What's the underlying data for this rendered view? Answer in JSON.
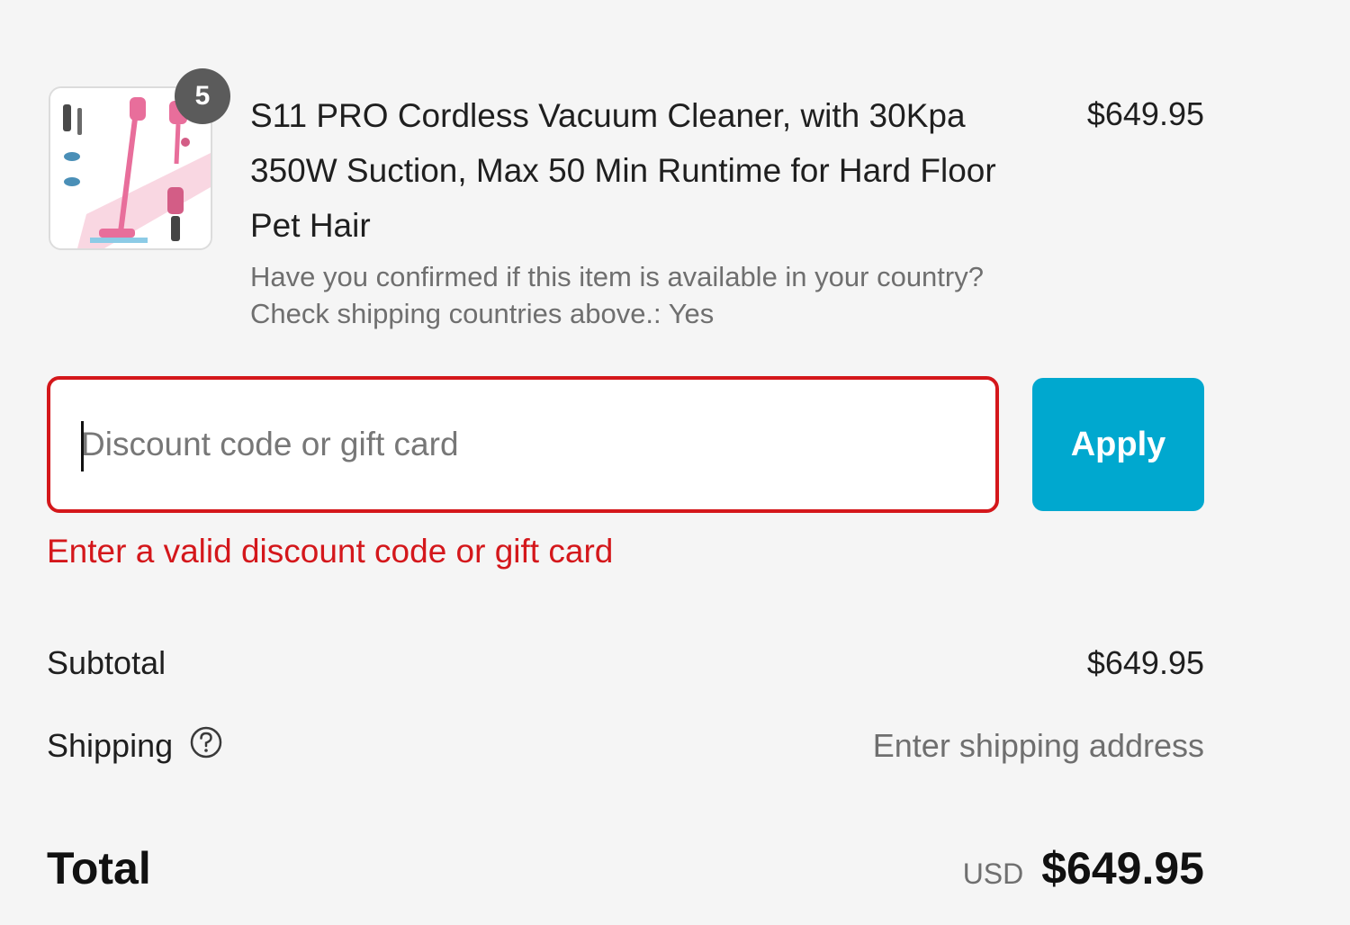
{
  "product": {
    "quantity": "5",
    "title": "S11 PRO Cordless Vacuum Cleaner, with 30Kpa 350W Suction, Max 50 Min Runtime for Hard Floor Pet Hair",
    "variant": "Have you confirmed if this item is available in your country? Check shipping countries above.: Yes",
    "price": "$649.95",
    "image_icon": "vacuum-cleaner-thumbnail"
  },
  "discount": {
    "placeholder": "Discount code or gift card",
    "value": "",
    "apply_label": "Apply",
    "error": "Enter a valid discount code or gift card"
  },
  "totals": {
    "subtotal_label": "Subtotal",
    "subtotal_value": "$649.95",
    "shipping_label": "Shipping",
    "shipping_value": "Enter shipping address",
    "total_label": "Total",
    "currency": "USD",
    "total_value": "$649.95"
  },
  "colors": {
    "apply_button": "#00a8cf",
    "error": "#d4171b",
    "badge": "#5b5b5b",
    "background": "#f5f5f5"
  }
}
